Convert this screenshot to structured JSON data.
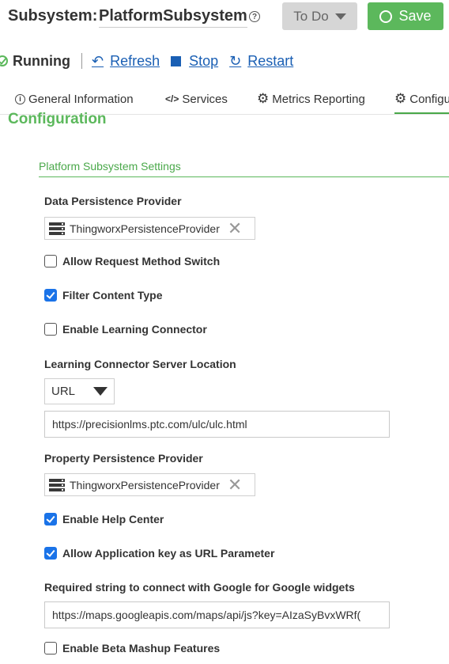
{
  "header": {
    "title_label": "Subsystem:",
    "title_name": "PlatformSubsystem",
    "help_glyph": "?",
    "status_button": "To Do",
    "save_button": "Save"
  },
  "status": {
    "state": "Running",
    "actions": {
      "refresh": "Refresh",
      "stop": "Stop",
      "restart": "Restart"
    }
  },
  "tabs": [
    {
      "label": "General Information",
      "icon": "info-icon"
    },
    {
      "label": "Services",
      "icon": "code-icon"
    },
    {
      "label": "Metrics Reporting",
      "icon": "gear-icon"
    },
    {
      "label": "Configu",
      "icon": "gear-icon",
      "active": true
    }
  ],
  "page": {
    "section_title": "Configuration",
    "group_title": "Platform Subsystem Settings"
  },
  "settings": {
    "data_persistence_label": "Data Persistence Provider",
    "data_persistence_value": "ThingworxPersistenceProvider",
    "allow_request_method_switch": {
      "label": "Allow Request Method Switch",
      "checked": false
    },
    "filter_content_type": {
      "label": "Filter Content Type",
      "checked": true
    },
    "enable_learning_connector": {
      "label": "Enable Learning Connector",
      "checked": false
    },
    "learning_connector_location_label": "Learning Connector Server Location",
    "learning_connector_type": "URL",
    "learning_connector_url": "https://precisionlms.ptc.com/ulc/ulc.html",
    "property_persistence_label": "Property Persistence Provider",
    "property_persistence_value": "ThingworxPersistenceProvider",
    "enable_help_center": {
      "label": "Enable Help Center",
      "checked": true
    },
    "allow_app_key_url": {
      "label": "Allow Application key as URL Parameter",
      "checked": true
    },
    "google_string_label": "Required string to connect with Google for Google widgets",
    "google_string_value": "https://maps.googleapis.com/maps/api/js?key=AIzaSyBvxWRf(",
    "enable_beta_mashup": {
      "label": "Enable Beta Mashup Features",
      "checked": false
    }
  },
  "colors": {
    "accent_green": "#5cb85c",
    "link_blue": "#1a5fb4",
    "checkbox_blue": "#1a73e8"
  }
}
